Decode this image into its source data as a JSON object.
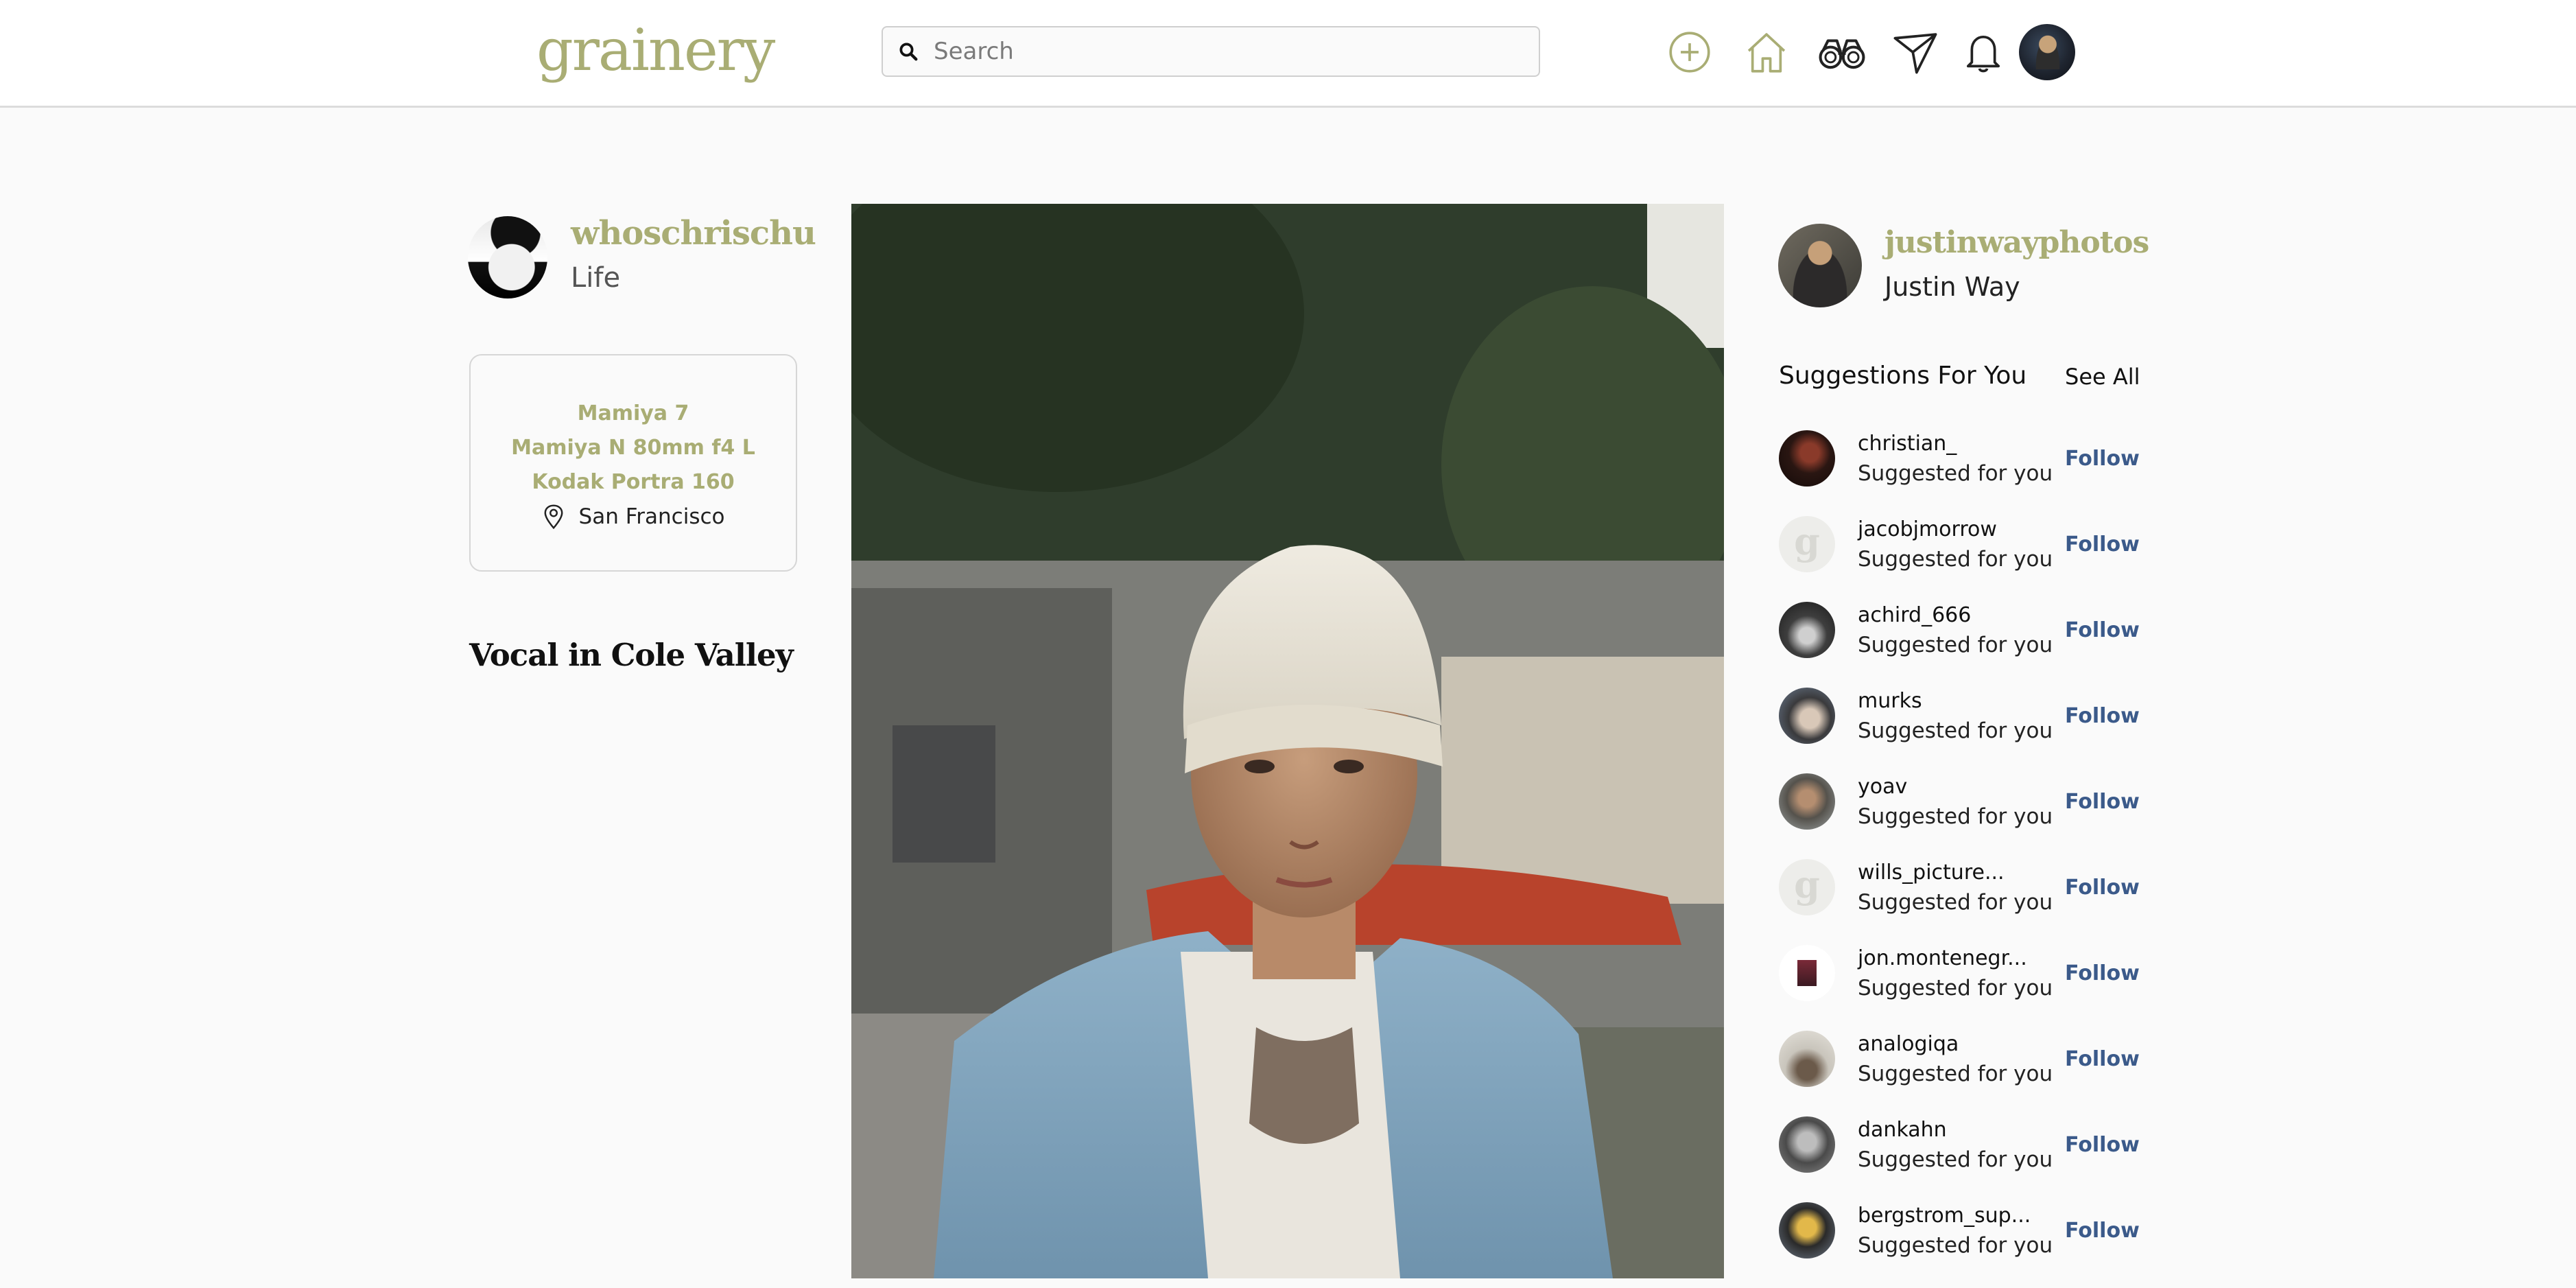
{
  "header": {
    "logo": "grainery",
    "search_placeholder": "Search",
    "nav_icons": [
      "plus-circle-icon",
      "home-icon",
      "binoculars-icon",
      "paper-plane-icon",
      "bell-icon",
      "profile-avatar"
    ]
  },
  "colors": {
    "accent": "#a9ad74",
    "link": "#3b5a8a",
    "background": "#fafafa"
  },
  "post": {
    "author": "whoschrischu",
    "author_subtitle": "Life",
    "camera": "Mamiya 7",
    "lens": "Mamiya N 80mm f4 L",
    "film": "Kodak Portra 160",
    "location": "San Francisco",
    "title": "Vocal in Cole Valley"
  },
  "current_user": {
    "username": "justinwayphotos",
    "full_name": "Justin Way"
  },
  "suggestions": {
    "heading": "Suggestions For You",
    "see_all": "See All",
    "follow_label": "Follow",
    "items": [
      {
        "username": "christian_",
        "subtitle": "Suggested for you",
        "avatar": "photo-dark"
      },
      {
        "username": "jacobjmorrow",
        "subtitle": "Suggested for you",
        "avatar": "placeholder-g"
      },
      {
        "username": "achird_666",
        "subtitle": "Suggested for you",
        "avatar": "photo-mono"
      },
      {
        "username": "murks",
        "subtitle": "Suggested for you",
        "avatar": "photo-grey"
      },
      {
        "username": "yoav",
        "subtitle": "Suggested for you",
        "avatar": "photo-portrait"
      },
      {
        "username": "wills_picture...",
        "subtitle": "Suggested for you",
        "avatar": "placeholder-g"
      },
      {
        "username": "jon.montenegr...",
        "subtitle": "Suggested for you",
        "avatar": "photo-small"
      },
      {
        "username": "analogiqa",
        "subtitle": "Suggested for you",
        "avatar": "photo-light"
      },
      {
        "username": "dankahn",
        "subtitle": "Suggested for you",
        "avatar": "photo-bw"
      },
      {
        "username": "bergstrom_sup...",
        "subtitle": "Suggested for you",
        "avatar": "photo-illustration"
      }
    ]
  }
}
